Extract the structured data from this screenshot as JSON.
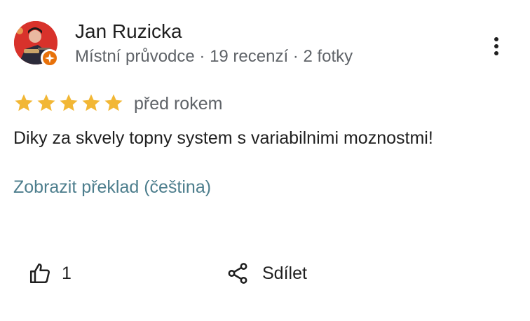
{
  "author": {
    "name": "Jan Ruzicka",
    "meta": "Místní průvodce · 19 recenzí · 2 fotky",
    "avatar_bg": "#d8322b",
    "badge_color": "#e8710a"
  },
  "rating": {
    "stars": 5,
    "max": 5,
    "star_color": "#f2b735"
  },
  "review": {
    "date": "před rokem",
    "text": "Diky za skvely topny system s variabilnimi moznostmi!",
    "translate_label": "Zobrazit překlad (čeština)"
  },
  "actions": {
    "like_count": "1",
    "share_label": "Sdílet",
    "like_icon": "thumb-up-icon",
    "share_icon": "share-icon",
    "more_icon": "more-vert-icon"
  }
}
